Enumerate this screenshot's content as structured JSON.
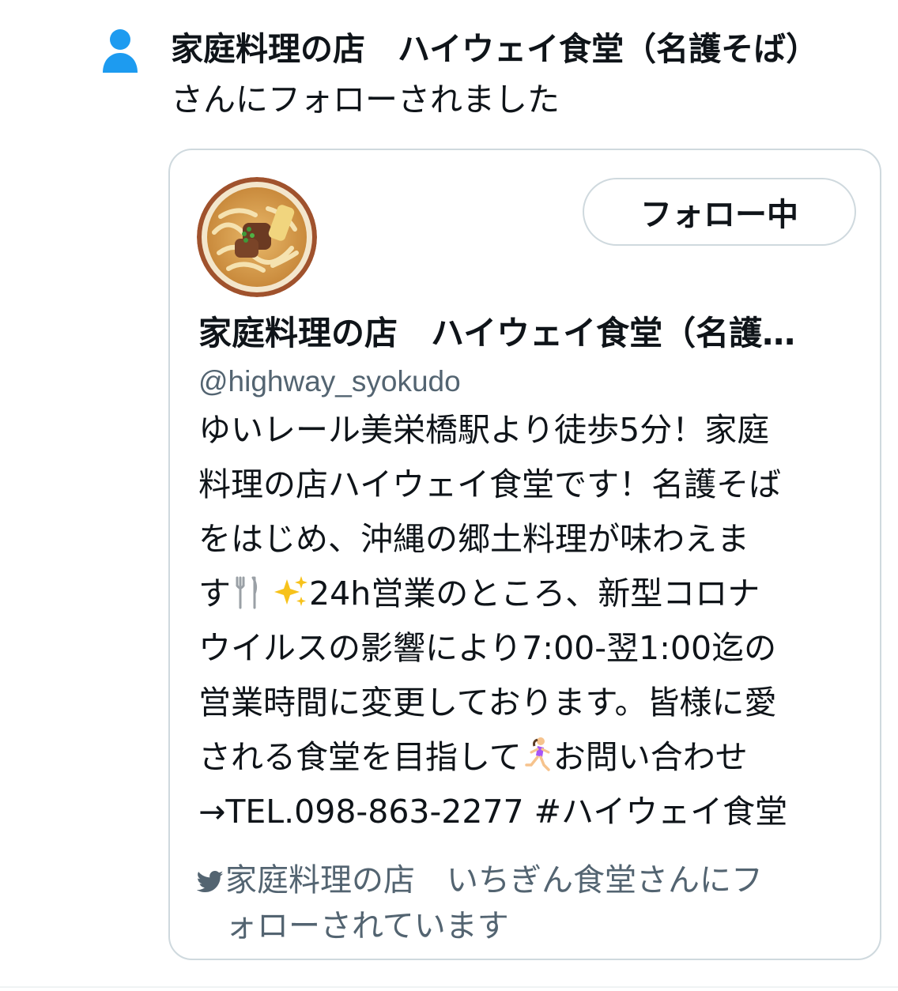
{
  "notification": {
    "icon": "person-icon",
    "account_name": "家庭料理の店　ハイウェイ食堂（名護そば）",
    "action_text": "さんにフォローされました"
  },
  "card": {
    "avatar_alt": "avatar",
    "follow_button": "フォロー中",
    "display_name": "家庭料理の店　ハイウェイ食堂（名護…",
    "handle": "@highway_syokudo",
    "bio_lines": [
      "ゆいレール美栄橋駅より徒歩5分！家庭",
      "料理の店ハイウェイ食堂です！名護そば",
      "をはじめ、沖縄の郷土料理が味わえま",
      "す",
      "24h営業のところ、新型コロナ",
      "ウイルスの影響により7:00-翌1:00迄の",
      "営業時間に変更しております。皆様に愛",
      "される食堂を目指して",
      "お問い合わせ",
      "→TEL.098-863-2277 #ハイウェイ食堂"
    ],
    "followed_by_line1": "家庭料理の店　いちぎん食堂さんにフ",
    "followed_by_line2": "ォローされています"
  },
  "colors": {
    "accent": "#1d9bf0",
    "text_primary": "#0f1419",
    "text_secondary": "#536471",
    "border": "#cfd9de"
  }
}
